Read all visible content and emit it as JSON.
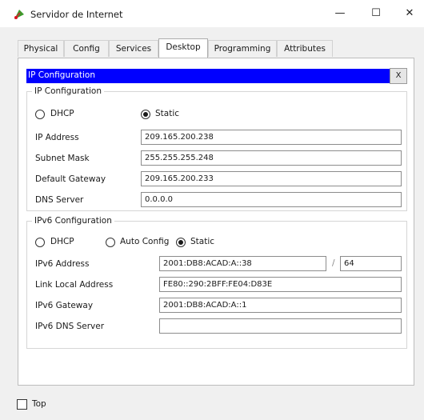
{
  "window": {
    "title": "Servidor de Internet",
    "icon": "router-leaf-icon",
    "controls": {
      "minimize": "—",
      "maximize": "☐",
      "close": "✕"
    }
  },
  "tabs": [
    {
      "label": "Physical",
      "active": false
    },
    {
      "label": "Config",
      "active": false
    },
    {
      "label": "Services",
      "active": false
    },
    {
      "label": "Desktop",
      "active": true
    },
    {
      "label": "Programming",
      "active": false
    },
    {
      "label": "Attributes",
      "active": false
    }
  ],
  "ip_config": {
    "title": "IP Configuration",
    "close_label": "X",
    "ipv4": {
      "legend": "IP Configuration",
      "mode": {
        "dhcp_label": "DHCP",
        "static_label": "Static",
        "selected": "Static"
      },
      "fields": {
        "ip_address": {
          "label": "IP Address",
          "value": "209.165.200.238"
        },
        "subnet_mask": {
          "label": "Subnet Mask",
          "value": "255.255.255.248"
        },
        "default_gateway": {
          "label": "Default Gateway",
          "value": "209.165.200.233"
        },
        "dns_server": {
          "label": "DNS Server",
          "value": "0.0.0.0"
        }
      }
    },
    "ipv6": {
      "legend": "IPv6 Configuration",
      "mode": {
        "dhcp_label": "DHCP",
        "auto_label": "Auto Config",
        "static_label": "Static",
        "selected": "Static"
      },
      "fields": {
        "address": {
          "label": "IPv6 Address",
          "value": "2001:DB8:ACAD:A::38",
          "prefix_separator": "/",
          "prefix": "64"
        },
        "link_local": {
          "label": "Link Local Address",
          "value": "FE80::290:2BFF:FE04:D83E"
        },
        "gateway": {
          "label": "IPv6 Gateway",
          "value": "2001:DB8:ACAD:A::1"
        },
        "dns_server": {
          "label": "IPv6 DNS Server",
          "value": ""
        }
      }
    }
  },
  "footer": {
    "top_checkbox_label": "Top",
    "top_checked": false
  },
  "colors": {
    "ip_bar": "#0000ff",
    "panel_bg": "#ffffff",
    "window_bg": "#f0f0f0"
  }
}
